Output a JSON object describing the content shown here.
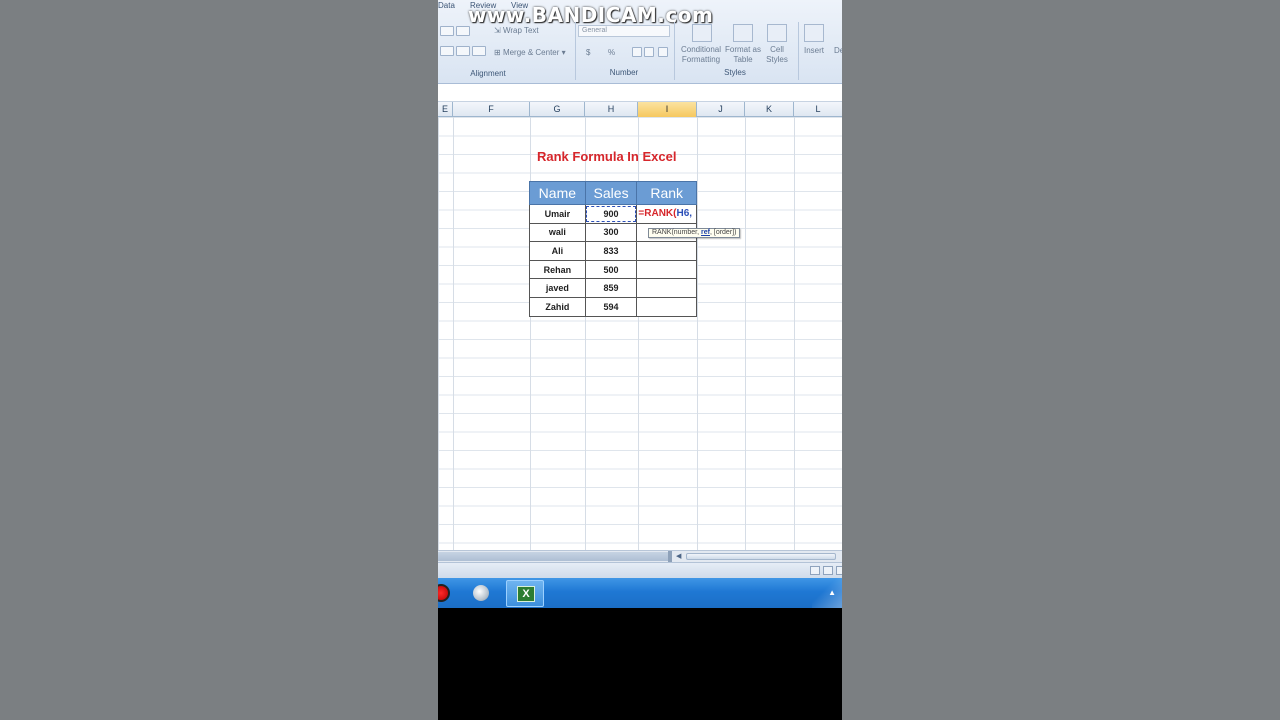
{
  "watermark": "www.BANDICAM.com",
  "ribbon": {
    "tabs": [
      "Data",
      "Review",
      "View"
    ],
    "wrap_text": "Wrap Text",
    "merge_center": "Merge & Center",
    "number_format": "General",
    "currency": "$",
    "percent": "%",
    "conditional_formatting": [
      "Conditional",
      "Formatting"
    ],
    "format_as_table": [
      "Format as",
      "Table"
    ],
    "cell_styles": [
      "Cell",
      "Styles"
    ],
    "insert": "Insert",
    "delete_partial": "De",
    "groups": {
      "alignment": "Alignment",
      "number": "Number",
      "styles": "Styles"
    }
  },
  "columns": [
    "E",
    "F",
    "G",
    "H",
    "I",
    "J",
    "K",
    "L"
  ],
  "active_column": "I",
  "sheet": {
    "title": "Rank Formula In Excel",
    "headers": [
      "Name",
      "Sales",
      "Rank"
    ],
    "rows": [
      {
        "name": "Umair",
        "sales": "900"
      },
      {
        "name": "wali",
        "sales": "300"
      },
      {
        "name": "Ali",
        "sales": "833"
      },
      {
        "name": "Rehan",
        "sales": "500"
      },
      {
        "name": "javed",
        "sales": "859"
      },
      {
        "name": "Zahid",
        "sales": "594"
      }
    ],
    "formula_editing": {
      "prefix": "=RANK(",
      "ref": "H6",
      "suffix": ",",
      "tooltip_fn": "RANK(number, ",
      "tooltip_arg": "ref",
      "tooltip_rest": ", [order])"
    }
  },
  "taskbar": {
    "apps": [
      "bandicam-record",
      "media-disc",
      "microsoft-excel"
    ],
    "excel_letter": "X"
  }
}
